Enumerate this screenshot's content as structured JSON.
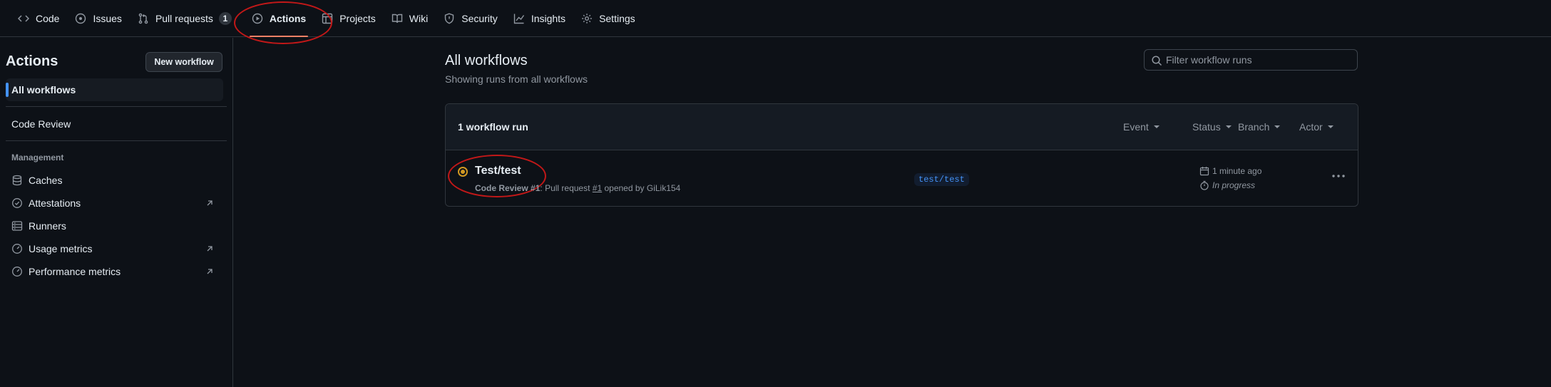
{
  "nav": {
    "tabs": [
      {
        "label": "Code",
        "icon": "code-icon"
      },
      {
        "label": "Issues",
        "icon": "issue-opened-icon"
      },
      {
        "label": "Pull requests",
        "icon": "git-pull-request-icon",
        "count": "1"
      },
      {
        "label": "Actions",
        "icon": "play-icon",
        "active": true
      },
      {
        "label": "Projects",
        "icon": "table-icon"
      },
      {
        "label": "Wiki",
        "icon": "book-icon"
      },
      {
        "label": "Security",
        "icon": "shield-icon"
      },
      {
        "label": "Insights",
        "icon": "graph-icon"
      },
      {
        "label": "Settings",
        "icon": "gear-icon"
      }
    ]
  },
  "sidebar": {
    "title": "Actions",
    "new_workflow": "New workflow",
    "all_workflows": "All workflows",
    "workflows": [
      "Code Review"
    ],
    "management_label": "Management",
    "management": [
      {
        "label": "Caches",
        "icon": "database-icon"
      },
      {
        "label": "Attestations",
        "icon": "verified-icon"
      },
      {
        "label": "Runners",
        "icon": "server-icon"
      },
      {
        "label": "Usage metrics",
        "icon": "meter-icon"
      },
      {
        "label": "Performance metrics",
        "icon": "meter-icon"
      }
    ]
  },
  "main": {
    "title": "All workflows",
    "subtitle": "Showing runs from all workflows",
    "filter_placeholder": "Filter workflow runs",
    "run_count": "1 workflow run",
    "filters": [
      "Event",
      "Status",
      "Branch",
      "Actor"
    ],
    "run": {
      "title": "Test/test",
      "workflow": "Code Review",
      "run_number": "#1",
      "meta_mid": ": Pull request ",
      "pr_link": "#1",
      "meta_end": " opened by GiLik154",
      "branch": "test/test",
      "time": "1 minute ago",
      "status": "In progress"
    }
  },
  "colors": {
    "background": "#0d1117",
    "accent_underline": "#f78166",
    "in_progress": "#d29922",
    "annotation": "#c21818",
    "link": "#4493f8"
  }
}
